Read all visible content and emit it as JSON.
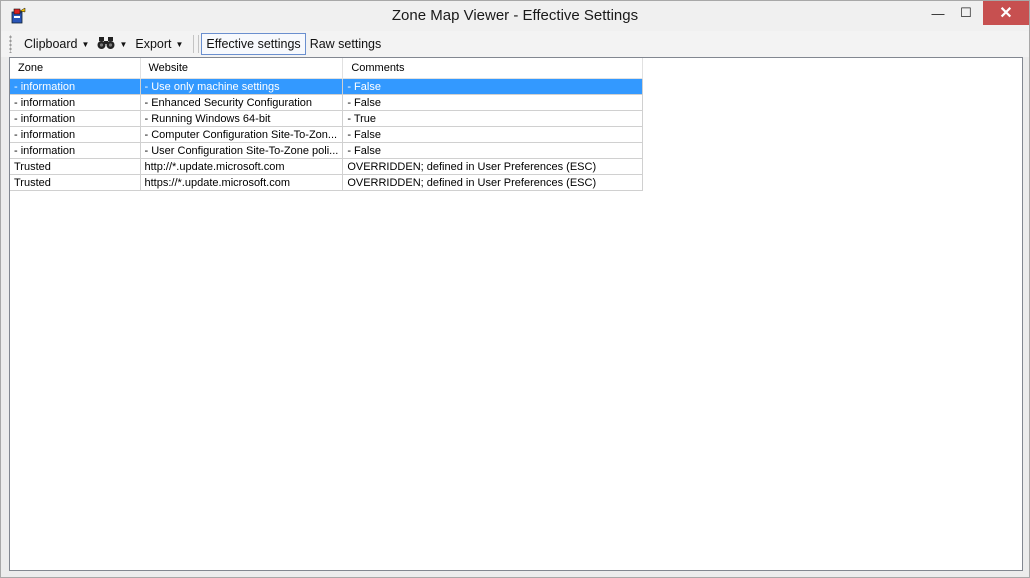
{
  "window": {
    "title": "Zone Map Viewer - Effective Settings"
  },
  "titlebar_buttons": {
    "minimize": "—",
    "maximize": "☐",
    "close": "✕"
  },
  "toolbar": {
    "clipboard_label": "Clipboard",
    "find_icon": "binoculars-icon",
    "export_label": "Export",
    "effective_label": "Effective settings",
    "raw_label": "Raw settings"
  },
  "table": {
    "columns": [
      "Zone",
      "Website",
      "Comments"
    ],
    "rows": [
      [
        "- information",
        "- Use only machine settings",
        "- False"
      ],
      [
        "- information",
        "- Enhanced Security Configuration",
        "- False"
      ],
      [
        "- information",
        "- Running Windows 64-bit",
        "- True"
      ],
      [
        "- information",
        "- Computer Configuration Site-To-Zon...",
        "- False"
      ],
      [
        "- information",
        "- User Configuration Site-To-Zone poli...",
        "- False"
      ],
      [
        "Trusted",
        "http://*.update.microsoft.com",
        "OVERRIDDEN; defined in User Preferences (ESC)"
      ],
      [
        "Trusted",
        "https://*.update.microsoft.com",
        "OVERRIDDEN; defined in User Preferences (ESC)"
      ]
    ],
    "selected_row": 0
  },
  "colors": {
    "selection": "#3399ff",
    "close_button": "#c75050"
  }
}
